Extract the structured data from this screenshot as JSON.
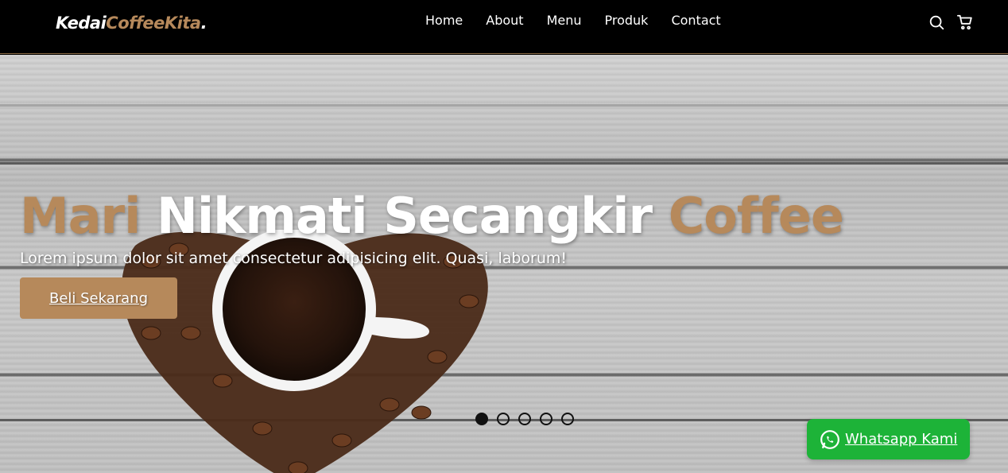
{
  "brand": {
    "part1": "Kedai",
    "part2": "CoffeeKita",
    "part3": "."
  },
  "nav": {
    "links": [
      "Home",
      "About",
      "Menu",
      "Produk",
      "Contact"
    ],
    "icons": [
      "search-icon",
      "cart-icon"
    ]
  },
  "hero": {
    "title_word1": "Mari",
    "title_word2": "Nikmati Secangkir",
    "title_word3": "Coffee",
    "subtitle": "Lorem ipsum dolor sit amet consectetur adipisicing elit. Quasi, laborum!",
    "cta_label": "Beli Sekarang",
    "carousel": {
      "count": 5,
      "active_index": 0
    }
  },
  "whatsapp": {
    "label": "Whatsapp Kami",
    "icon": "whatsapp-icon"
  },
  "colors": {
    "accent": "#b6895b",
    "navbar": "#000000",
    "whatsapp": "#1db338"
  }
}
